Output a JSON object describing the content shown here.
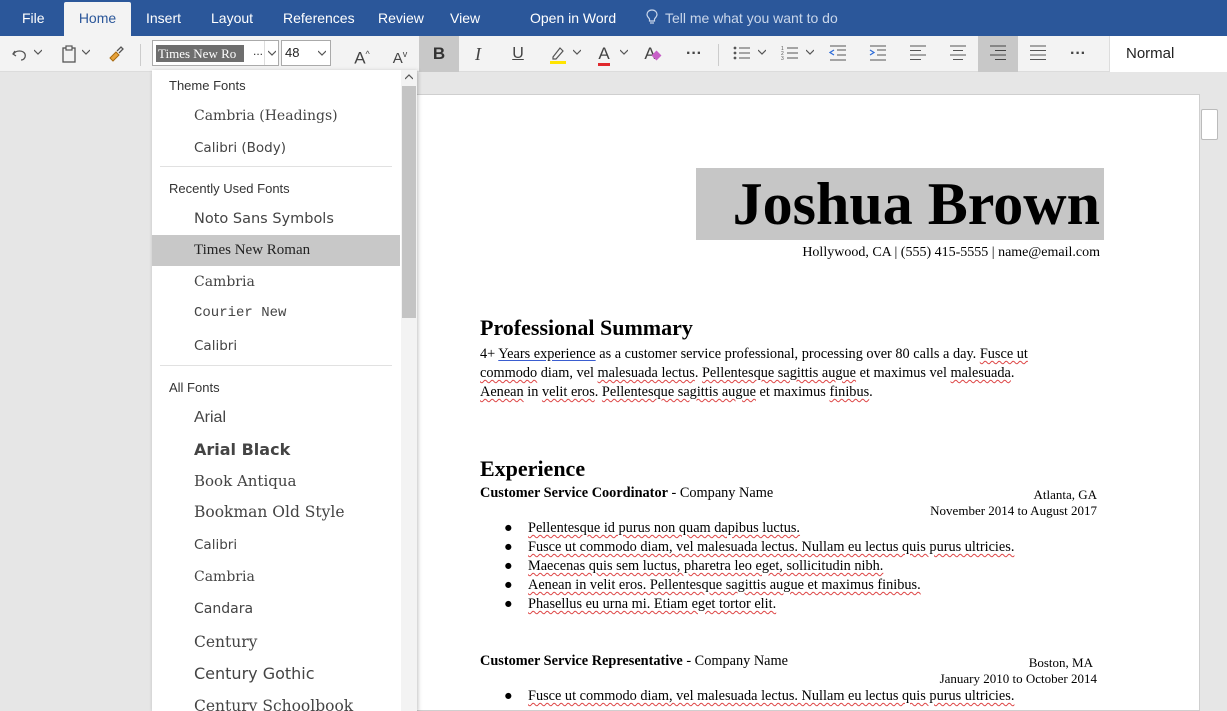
{
  "menu": {
    "file": "File",
    "home": "Home",
    "insert": "Insert",
    "layout": "Layout",
    "references": "References",
    "review": "Review",
    "view": "View",
    "open_in_word": "Open in Word",
    "tell_me": "Tell me what you want to do"
  },
  "ribbon": {
    "font_value": "Times New Ro",
    "font_more": "...",
    "size_value": "48",
    "bold_label": "B",
    "italic_label": "I",
    "underline_label": "U",
    "grow_label": "A",
    "shrink_label": "A",
    "font_color_label": "A",
    "clear_format_label": "A",
    "more_label": "···",
    "style_value": "Normal"
  },
  "font_dropdown": {
    "theme_header": "Theme Fonts",
    "theme_fonts": [
      "Cambria (Headings)",
      "Calibri (Body)"
    ],
    "recent_header": "Recently Used Fonts",
    "recent_fonts": [
      "Noto Sans Symbols",
      "Times New Roman",
      "Cambria",
      "Courier New",
      "Calibri"
    ],
    "all_header": "All Fonts",
    "all_fonts": [
      "Arial",
      "Arial Black",
      "Book Antiqua",
      "Bookman Old Style",
      "Calibri",
      "Cambria",
      "Candara",
      "Century",
      "Century Gothic",
      "Century Schoolbook"
    ]
  },
  "document": {
    "name": "Joshua Brown",
    "contact": "Hollywood, CA | (555) 415-5555 | name@email.com",
    "summary_heading": "Professional Summary",
    "summary_prefix": "4+ ",
    "summary_link": "Years experience",
    "summary_p1": " as a customer service professional, processing over 80 calls a day. ",
    "summary_w1": "Fusce ut",
    "summary_w2": "commodo",
    "summary_p2": " diam, vel ",
    "summary_w3": "malesuada lectus",
    "summary_p3": ". ",
    "summary_w4": "Pellentesque sagittis augue",
    "summary_p4": " et maximus vel ",
    "summary_w5": "malesuada",
    "summary_p5": ". ",
    "summary_w6": "Aenean",
    "summary_p6": " in ",
    "summary_w7": "velit eros",
    "summary_p7": ". ",
    "summary_w8": "Pellentesque sagittis augue",
    "summary_p8": " et maximus ",
    "summary_w9": "finibus",
    "summary_p9": ".",
    "experience_heading": "Experience",
    "jobs": [
      {
        "title": "Customer Service Coordinator",
        "company": " - Company Name",
        "location": "Atlanta, GA",
        "dates": "November 2014 to August 2017",
        "bullets": [
          "Pellentesque id purus non quam dapibus luctus.",
          "Fusce ut commodo diam, vel malesuada lectus. Nullam eu lectus quis purus ultricies.",
          "Maecenas quis sem luctus, pharetra leo eget, sollicitudin nibh.",
          "Aenean in velit eros. Pellentesque sagittis augue et maximus finibus.",
          "Phasellus eu urna mi. Etiam eget tortor elit."
        ]
      },
      {
        "title": "Customer Service Representative",
        "company": " - Company Name",
        "location": "Boston, MA",
        "dates": "January 2010 to October 2014",
        "bullets": [
          "Fusce ut commodo diam, vel malesuada lectus. Nullam eu lectus quis purus ultricies."
        ]
      }
    ]
  },
  "colors": {
    "brand": "#2b579a",
    "ribbon": "#f3f3f3",
    "highlight": "#c8c8c8"
  },
  "icons": [
    "undo-icon",
    "paste-icon",
    "format-painter-icon",
    "highlighter-icon",
    "bullets-icon",
    "numbering-icon",
    "decrease-indent-icon",
    "increase-indent-icon",
    "align-left-icon",
    "align-center-icon",
    "align-right-icon",
    "justify-icon",
    "lightbulb-icon"
  ]
}
